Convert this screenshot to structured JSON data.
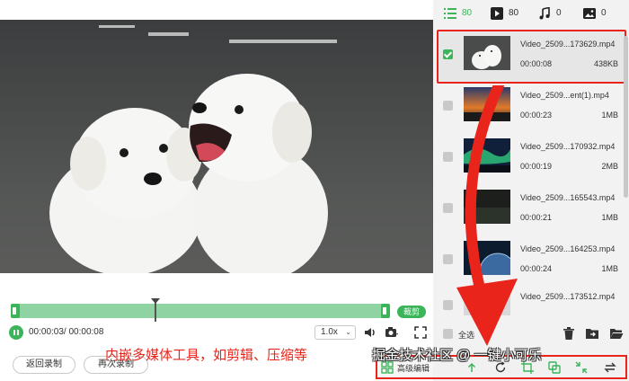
{
  "player": {
    "clip_label": "裁剪",
    "time_readout": "00:00:03/ 00:00:08",
    "speed": "1.0x",
    "progress": 0.375
  },
  "buttons": {
    "back_label": "返回录制",
    "again_label": "再次录制"
  },
  "annotation": {
    "text": "内嵌多媒体工具，如剪辑、压缩等",
    "color": "#e8241b"
  },
  "watermark": {
    "text": "掘金技术社区 @ 一键小可乐"
  },
  "filter_tabs": [
    {
      "name": "all",
      "icon": "list-icon",
      "count": "80"
    },
    {
      "name": "video",
      "icon": "play-icon",
      "count": "80"
    },
    {
      "name": "audio",
      "icon": "music-note-icon",
      "count": "0"
    },
    {
      "name": "image",
      "icon": "image-icon",
      "count": "0"
    }
  ],
  "files": [
    {
      "name": "Video_2509...173629.mp4",
      "duration": "00:00:08",
      "size": "438KB",
      "checked": true,
      "thumb": "puppies"
    },
    {
      "name": "Video_2509...ent(1).mp4",
      "duration": "00:00:23",
      "size": "1MB",
      "checked": false,
      "thumb": "sunset"
    },
    {
      "name": "Video_2509...170932.mp4",
      "duration": "00:00:19",
      "size": "2MB",
      "checked": false,
      "thumb": "aurora"
    },
    {
      "name": "Video_2509...165543.mp4",
      "duration": "00:00:21",
      "size": "1MB",
      "checked": false,
      "thumb": "dark"
    },
    {
      "name": "Video_2509...164253.mp4",
      "duration": "00:00:24",
      "size": "1MB",
      "checked": false,
      "thumb": "planet"
    },
    {
      "name": "Video_2509...173512.mp4",
      "duration": "",
      "size": "",
      "checked": false,
      "thumb": "plain"
    }
  ],
  "select_all_label": "全选",
  "edit_toolbar": {
    "label": "高级编辑"
  },
  "colors": {
    "accent": "#3cb45a",
    "highlight": "#e8241b"
  }
}
